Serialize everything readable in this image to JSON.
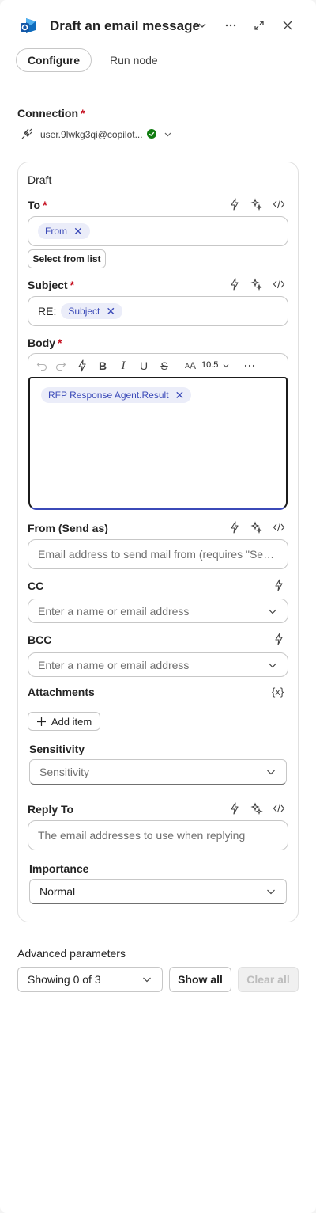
{
  "header": {
    "title": "Draft an email message",
    "icons": [
      "outlook-app-icon",
      "chevron-down-icon",
      "more-icon",
      "expand-icon",
      "close-icon"
    ]
  },
  "tabs": {
    "configure": "Configure",
    "run": "Run node"
  },
  "connection": {
    "label": "Connection",
    "required": "*",
    "value": "user.9lwkg3qi@copilot...",
    "status_color": "#107c10"
  },
  "card": {
    "title": "Draft",
    "to": {
      "label": "To",
      "required": "*",
      "token": "From",
      "select_from_list": "Select from list"
    },
    "subject": {
      "label": "Subject",
      "required": "*",
      "prefix": "RE:",
      "token": "Subject"
    },
    "body": {
      "label": "Body",
      "required": "*",
      "font_size": "10.5",
      "token": "RFP Response Agent.Result"
    },
    "from_send_as": {
      "label": "From (Send as)",
      "placeholder": "Email address to send mail from (requires \"Sen..."
    },
    "cc": {
      "label": "CC",
      "placeholder": "Enter a name or email address"
    },
    "bcc": {
      "label": "BCC",
      "placeholder": "Enter a name or email address"
    },
    "attachments": {
      "label": "Attachments",
      "variable_icon": "{x}",
      "add_item": "Add item"
    },
    "sensitivity": {
      "label": "Sensitivity",
      "placeholder": "Sensitivity"
    },
    "reply_to": {
      "label": "Reply To",
      "placeholder": "The email addresses to use when replying"
    },
    "importance": {
      "label": "Importance",
      "value": "Normal"
    }
  },
  "advanced": {
    "label": "Advanced parameters",
    "showing": "Showing 0 of 3",
    "show_all": "Show all",
    "clear_all": "Clear all"
  },
  "colors": {
    "accent": "#3b4ab8",
    "token_bg": "#ebedf9",
    "required": "#c50f1f"
  }
}
